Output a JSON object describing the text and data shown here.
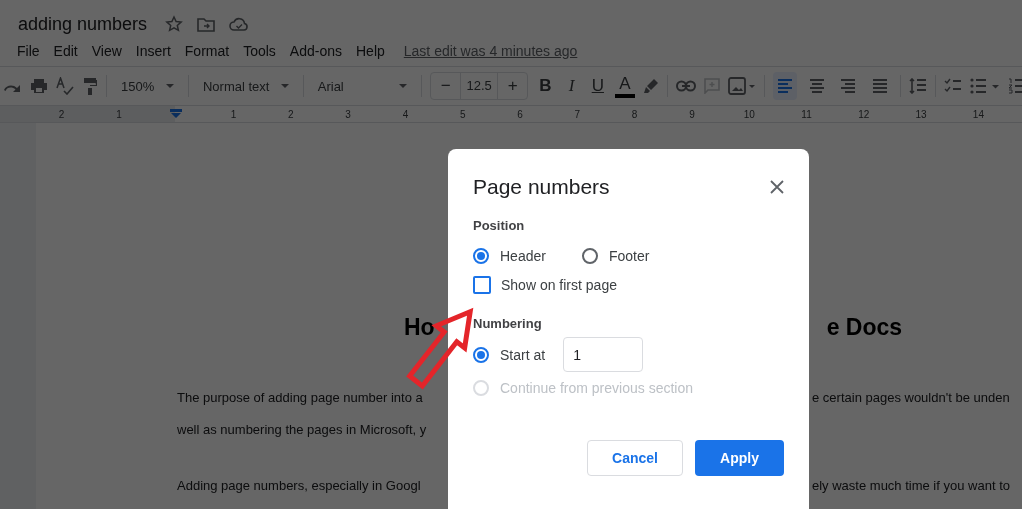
{
  "document": {
    "title": "adding numbers",
    "menu": [
      "File",
      "Edit",
      "View",
      "Insert",
      "Format",
      "Tools",
      "Add-ons",
      "Help"
    ],
    "last_edit": "Last edit was 4 minutes ago"
  },
  "toolbar": {
    "zoom": "150%",
    "style": "Normal text",
    "font": "Arial",
    "decrease": "−",
    "font_size": "12.5",
    "increase": "+",
    "bold": "B",
    "italic": "I",
    "underline": "U",
    "text_color": "A",
    "alignments": [
      {
        "kind": "left",
        "selected": true
      },
      {
        "kind": "center",
        "selected": false
      },
      {
        "kind": "right",
        "selected": false
      },
      {
        "kind": "justify",
        "selected": false
      }
    ]
  },
  "ruler": [
    "2",
    "1",
    "1",
    "2",
    "3",
    "4",
    "5",
    "6",
    "7",
    "8",
    "9",
    "10",
    "11",
    "12",
    "13",
    "14"
  ],
  "page": {
    "heading_left": "Ho",
    "heading_right": "e Docs",
    "lines": [
      {
        "left": "The purpose of adding page number into a",
        "right": "e certain pages wouldn't be unden"
      },
      {
        "left": "well as numbering the pages in Microsoft, y"
      },
      {
        "left": "Adding page numbers, especially in Googl",
        "right": "ely waste much time if you want to"
      }
    ]
  },
  "dialog": {
    "title": "Page numbers",
    "position_label": "Position",
    "position_options": [
      {
        "label": "Header",
        "selected": true
      },
      {
        "label": "Footer",
        "selected": false
      }
    ],
    "first_page": {
      "label": "Show on first page",
      "checked": false
    },
    "numbering_label": "Numbering",
    "numbering_options": [
      {
        "label": "Start at",
        "selected": true,
        "disabled": false
      },
      {
        "label": "Continue from previous section",
        "selected": false,
        "disabled": true
      }
    ],
    "start_value": "1",
    "cancel": "Cancel",
    "apply": "Apply"
  }
}
